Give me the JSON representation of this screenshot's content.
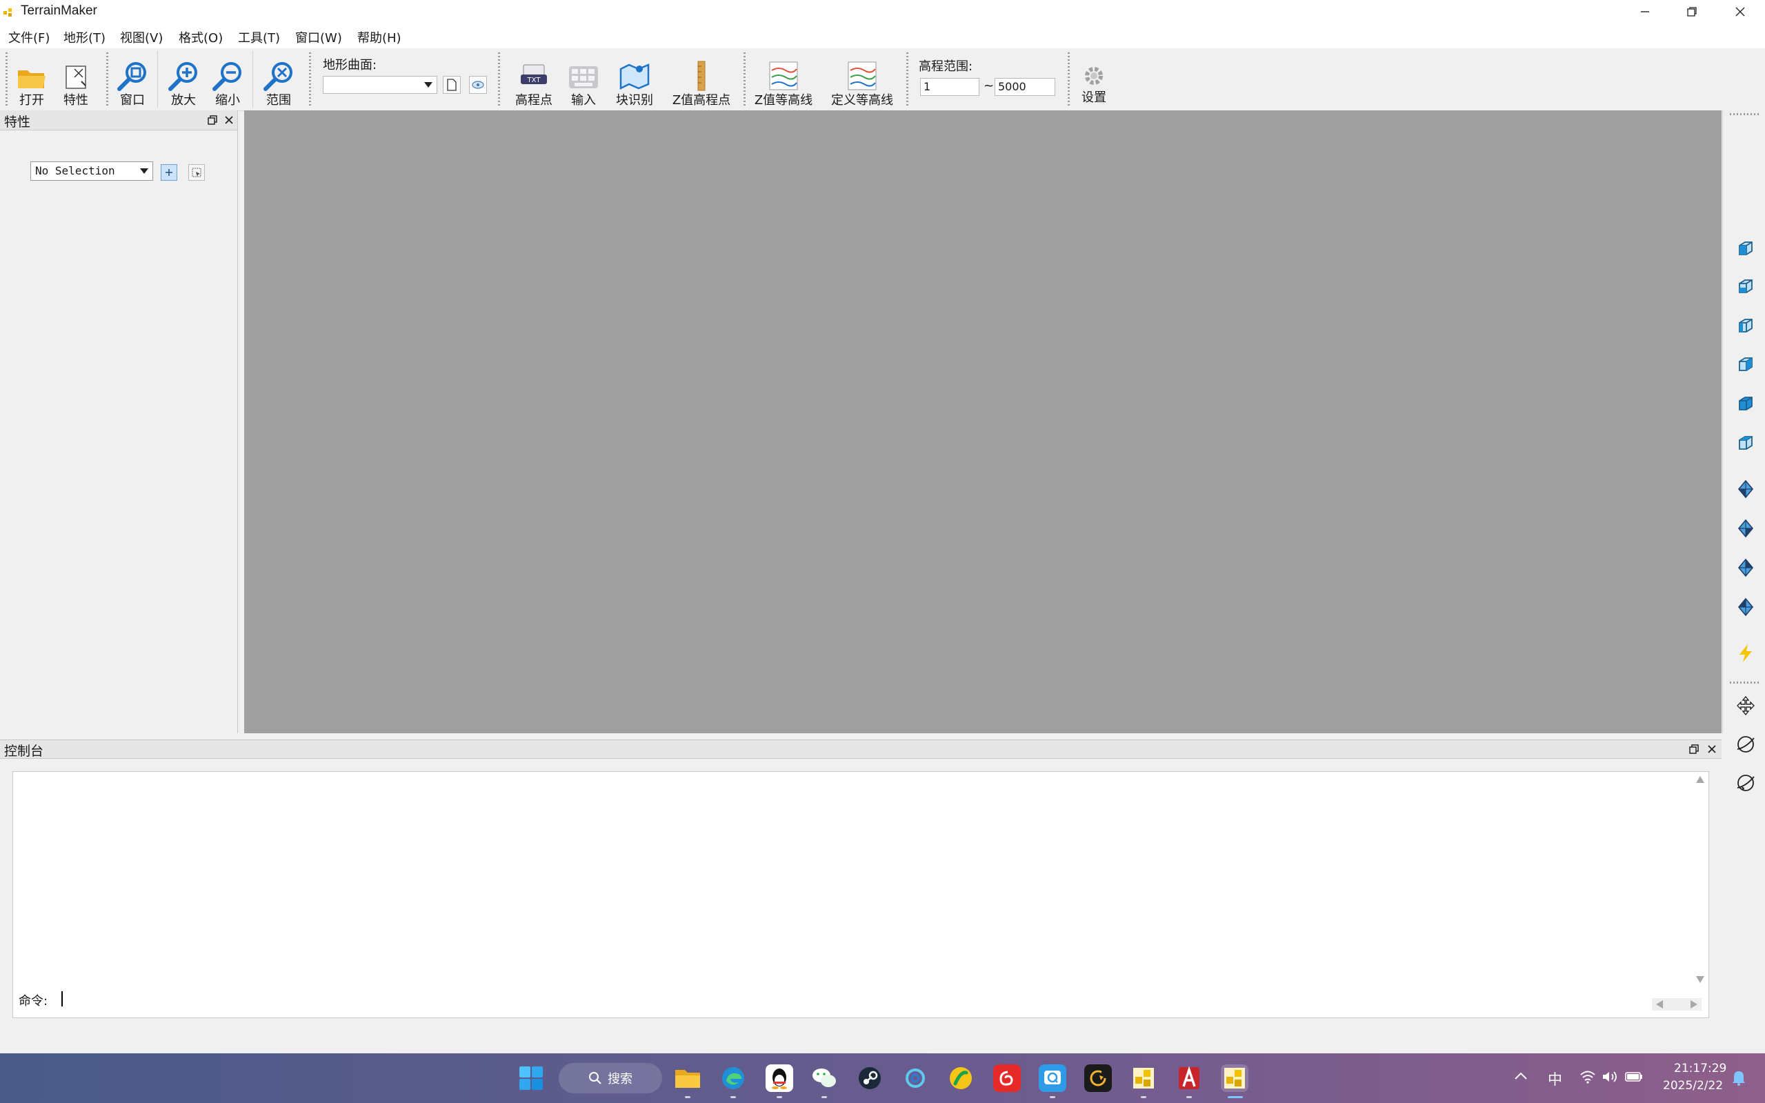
{
  "window": {
    "title": "TerrainMaker"
  },
  "menu": {
    "items": [
      "文件(F)",
      "地形(T)",
      "视图(V)",
      "格式(O)",
      "工具(T)",
      "窗口(W)",
      "帮助(H)"
    ]
  },
  "toolbar": {
    "open": "打开",
    "properties": "特性",
    "window": "窗口",
    "zoom_in": "放大",
    "zoom_out": "缩小",
    "extent": "范围",
    "surface_label": "地形曲面:",
    "surface_value": "",
    "elev_points": "高程点",
    "import": "输入",
    "block_recognize": "块识别",
    "z_elev_points": "Z值高程点",
    "z_contours": "Z值等高线",
    "define_contours": "定义等高线",
    "elev_range_label": "高程范围:",
    "elev_min": "1",
    "elev_dash": "~",
    "elev_max": "5000",
    "settings": "设置"
  },
  "properties_panel": {
    "title": "特性",
    "selection": "No Selection"
  },
  "console": {
    "title": "控制台",
    "command_label": "命令:"
  },
  "taskbar": {
    "search": "搜索",
    "ime": "中",
    "time": "21:17:29",
    "date": "2025/2/22"
  },
  "colors": {
    "canvas": "#a0a0a0",
    "accent_blue": "#1e73c8",
    "taskbar_start": "#4a5b88"
  }
}
